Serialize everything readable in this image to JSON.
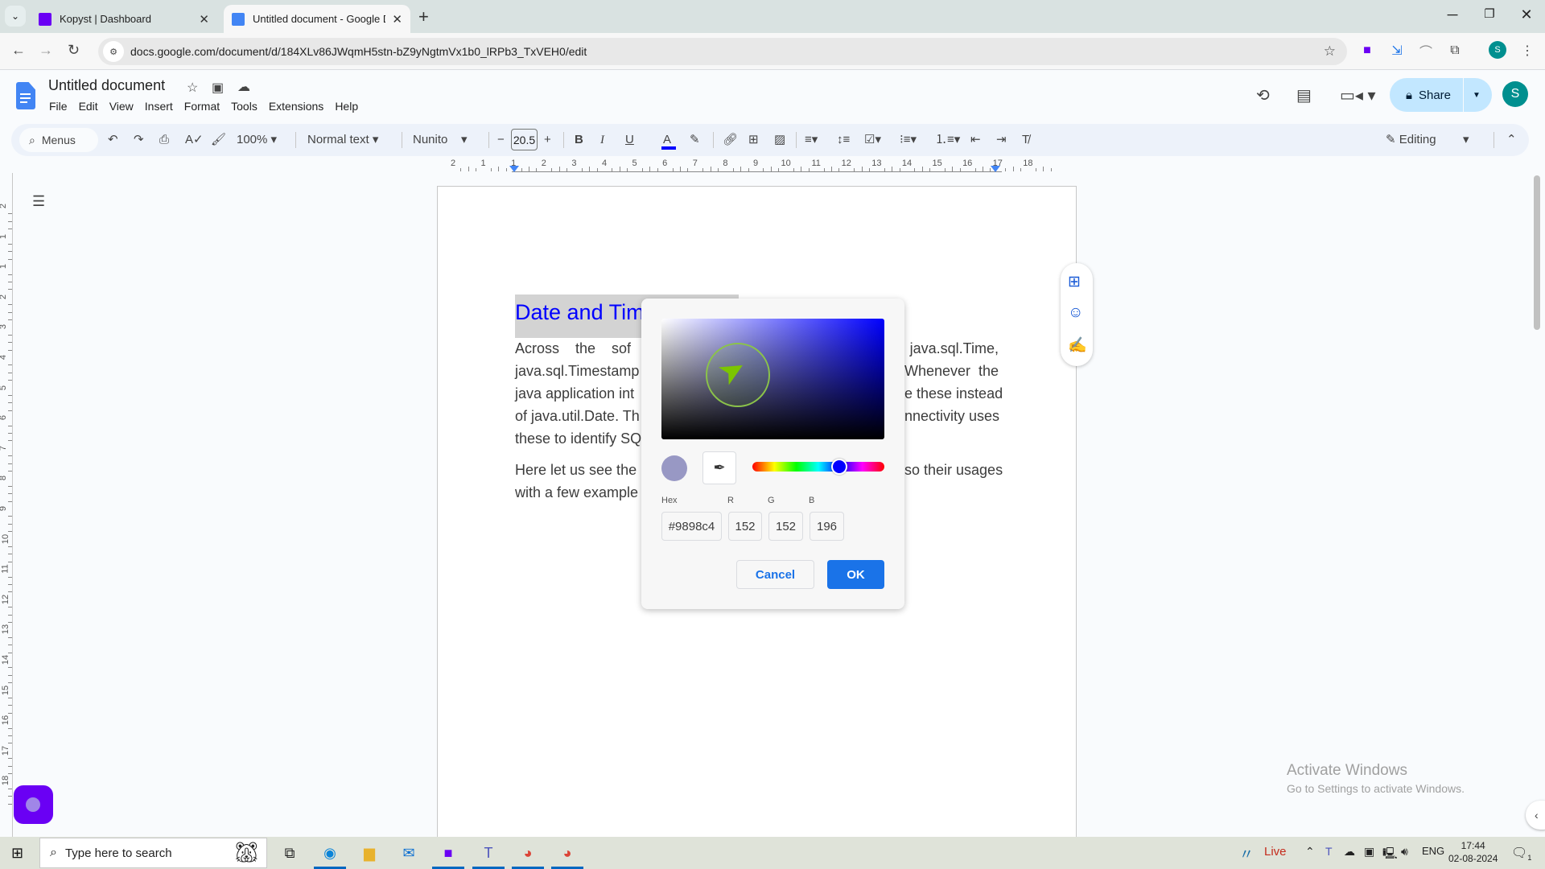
{
  "browser": {
    "tabs": [
      {
        "title": "Kopyst | Dashboard",
        "icon": "kopyst-icon",
        "active": false
      },
      {
        "title": "Untitled document - Google Do",
        "icon": "google-docs-icon",
        "active": true
      }
    ],
    "url": "docs.google.com/document/d/184XLv86JWqmH5stn-bZ9yNgtmVx1b0_lRPb3_TxVEH0/edit",
    "profile_initial": "S",
    "new_tab_label": "+"
  },
  "docs": {
    "title": "Untitled document",
    "menu": [
      "File",
      "Edit",
      "View",
      "Insert",
      "Format",
      "Tools",
      "Extensions",
      "Help"
    ],
    "share_label": "Share",
    "avatar_initial": "S",
    "toolbar": {
      "menus_search": "Menus",
      "zoom": "100%",
      "style": "Normal text",
      "font": "Nunito",
      "font_size": "20.5",
      "mode": "Editing",
      "text_color": "#0000ff"
    },
    "ruler_numbers": [
      "2",
      "1",
      "1",
      "2",
      "3",
      "4",
      "5",
      "6",
      "7",
      "8",
      "9",
      "10",
      "11",
      "12",
      "13",
      "14",
      "15",
      "16",
      "17",
      "18"
    ],
    "left_ruler_numbers": [
      "2",
      "1",
      "1",
      "2",
      "3",
      "4",
      "5",
      "6",
      "7",
      "8",
      "9",
      "10",
      "11",
      "12",
      "13",
      "14",
      "15",
      "16",
      "17",
      "18"
    ],
    "content": {
      "heading": "Date and Tim",
      "para1_lines": [
        {
          "left": "Across    the    sof",
          "right": "java.sql.Time,"
        },
        {
          "left": "java.sql.Timestamp",
          "right": "Whenever  the"
        },
        {
          "left": "java application int",
          "right": "e these instead"
        },
        {
          "left": "of java.util.Date. Th",
          "right": "nnectivity uses"
        },
        {
          "left": "these to identify SQ",
          "right": ""
        }
      ],
      "para2_lines": [
        {
          "left": "Here let us see the",
          "right": "so their usages"
        },
        {
          "left": "with a few example",
          "right": ""
        }
      ]
    }
  },
  "color_picker": {
    "hex_label": "Hex",
    "r_label": "R",
    "g_label": "G",
    "b_label": "B",
    "hex_value": "#9898c4",
    "r_value": "152",
    "g_value": "152",
    "b_value": "196",
    "selected_color": "#9898c4",
    "hue_color": "#0000ff",
    "hue_position_fraction": 0.66,
    "cancel_label": "Cancel",
    "ok_label": "OK"
  },
  "watermark": {
    "title": "Activate Windows",
    "subtitle": "Go to Settings to activate Windows."
  },
  "taskbar": {
    "search_placeholder": "Type here to search",
    "weather_label": "Live",
    "language": "ENG",
    "time": "17:44",
    "date": "02-08-2024",
    "notification_count": "1"
  }
}
